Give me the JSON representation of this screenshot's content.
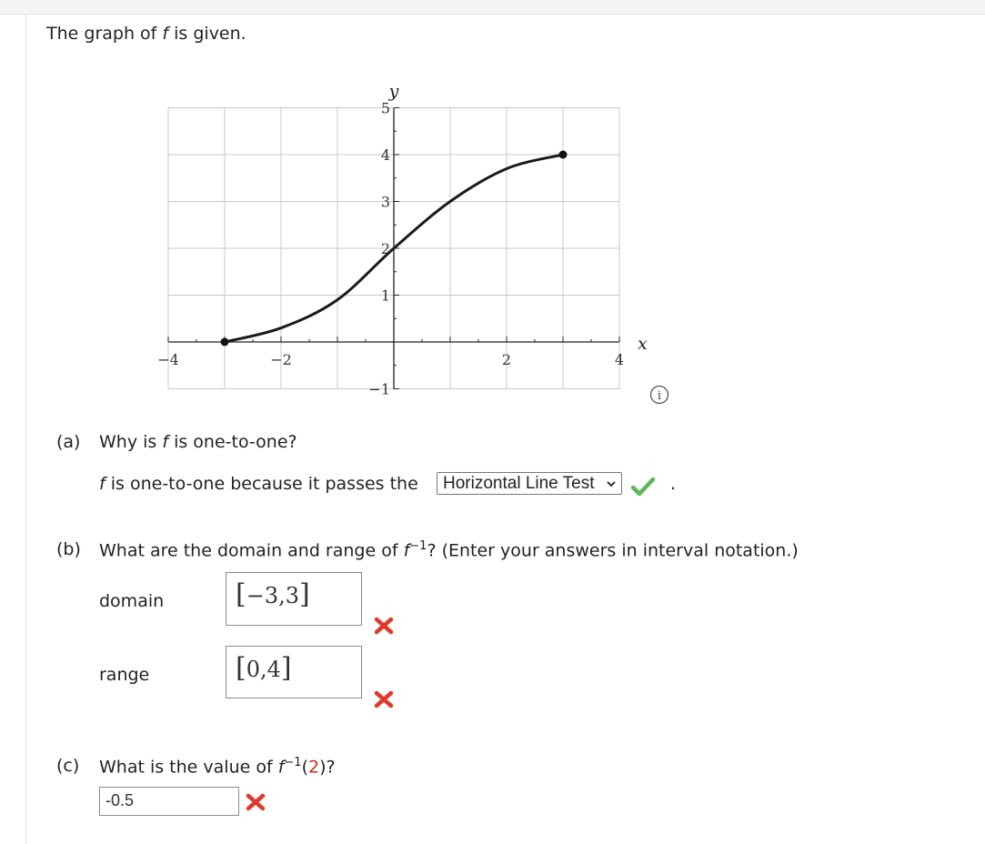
{
  "intro": {
    "prefix": "The graph of ",
    "f": "f",
    "suffix": " is given."
  },
  "chart_data": {
    "type": "line",
    "title": "",
    "xlabel": "x",
    "ylabel": "y",
    "xlim": [
      -4,
      4
    ],
    "ylim": [
      -1,
      5
    ],
    "x_ticks": [
      "−4",
      "−2",
      "2",
      "4"
    ],
    "y_ticks": [
      "−1",
      "1",
      "2",
      "3",
      "4",
      "5"
    ],
    "grid": true,
    "series": [
      {
        "x": [
          -3,
          -2,
          -1,
          0,
          1,
          2,
          3
        ],
        "y": [
          0,
          0.3,
          0.9,
          2,
          3,
          3.7,
          4
        ]
      }
    ],
    "endpoints": [
      [
        -3,
        0
      ],
      [
        3,
        4
      ]
    ]
  },
  "info_icon": "info-icon",
  "part_a": {
    "label": "(a)",
    "question_prefix": "Why is ",
    "f": "f",
    "question_suffix": " is one-to-one?",
    "answer_f": "f",
    "answer_text": " is one-to-one because it passes the",
    "select_value": "Horizontal Line Test",
    "period": ".",
    "status": "correct"
  },
  "part_b": {
    "label": "(b)",
    "question_prefix": "What are the domain and range of ",
    "f": "f",
    "sup": "−1",
    "question_suffix": "? (Enter your answers in interval notation.)",
    "domain_label": "domain",
    "domain_value": "−3,3",
    "domain_open": "[",
    "domain_close": "]",
    "range_label": "range",
    "range_value": "0,4",
    "range_open": "[",
    "range_close": "]",
    "status": "incorrect"
  },
  "part_c": {
    "label": "(c)",
    "question_prefix": "What is the value of ",
    "f": "f",
    "sup": "−1",
    "open": "(",
    "arg": "2",
    "close": ")?",
    "answer": "-0.5",
    "status": "incorrect"
  },
  "colors": {
    "correct": "#5cb85c",
    "incorrect": "#e0392b",
    "accent_red": "#cc2a1a"
  }
}
